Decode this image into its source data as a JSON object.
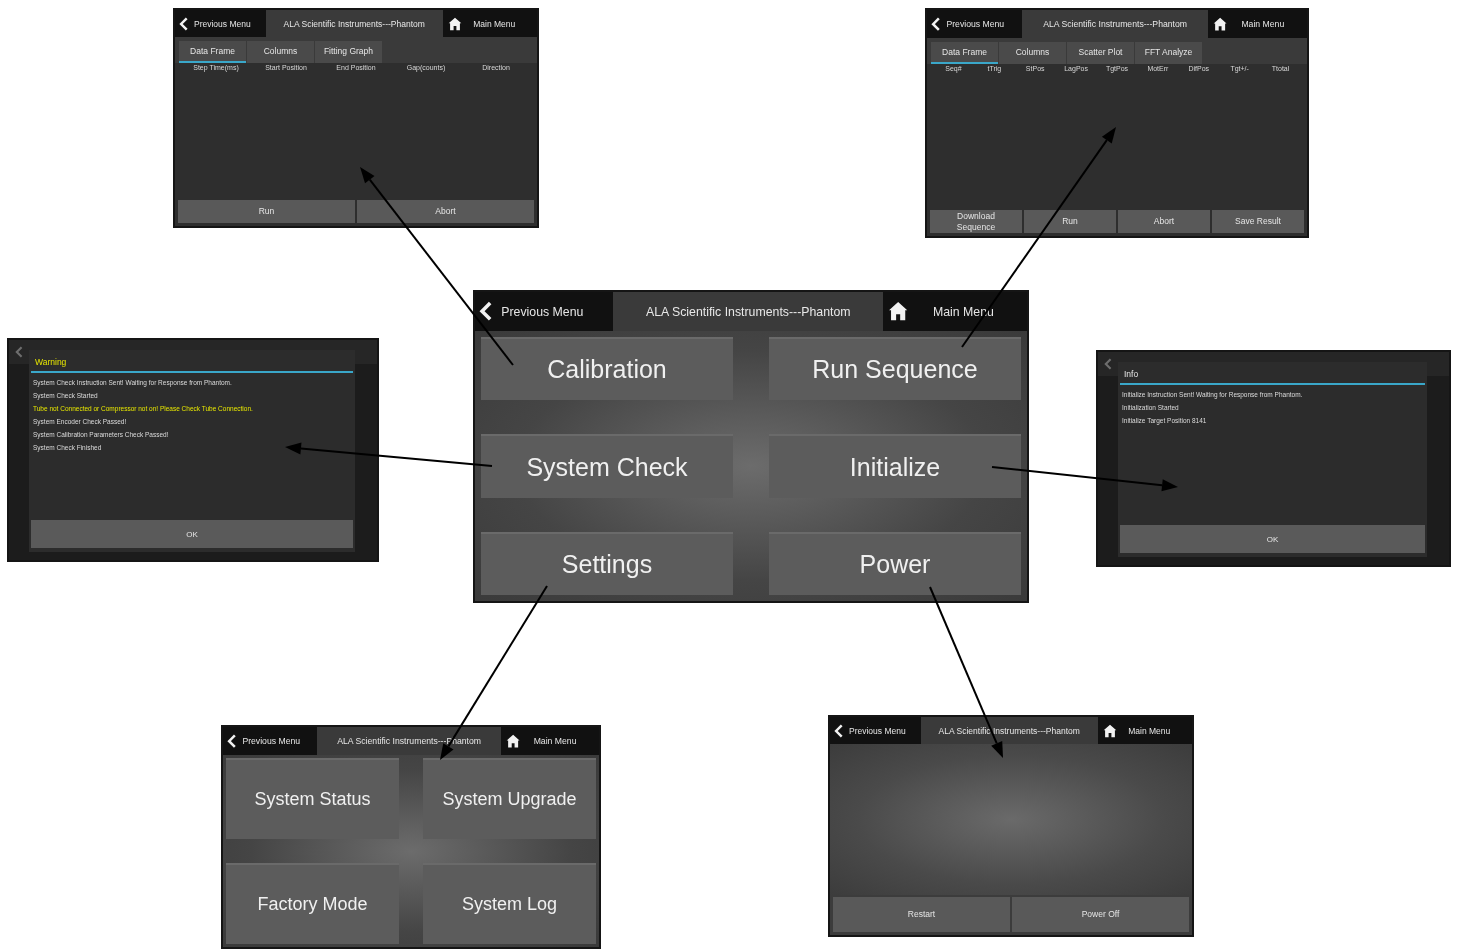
{
  "screens": [
    {
      "kind": "menu",
      "header": {
        "back": "Previous Menu",
        "title": "ALA Scientific Instruments---Phantom",
        "home": "Main Menu"
      },
      "buttons": [
        "Calibration",
        "Run Sequence",
        "System Check",
        "Initialize",
        "Settings",
        "Power"
      ]
    },
    {
      "kind": "table",
      "header": {
        "back": "Previous Menu",
        "title": "ALA Scientific Instruments---Phantom",
        "home": "Main Menu"
      },
      "tabs": [
        {
          "label": "Data Frame",
          "selected": true
        },
        {
          "label": "Columns",
          "selected": false
        },
        {
          "label": "Fitting Graph",
          "selected": false
        }
      ],
      "columns": [
        "Step Time(ms)",
        "Start Position",
        "End Position",
        "Gap(counts)",
        "Direction"
      ],
      "buttons": [
        "Run",
        "Abort"
      ]
    },
    {
      "kind": "table",
      "header": {
        "back": "Previous Menu",
        "title": "ALA Scientific Instruments---Phantom",
        "home": "Main Menu"
      },
      "tabs": [
        {
          "label": "Data Frame",
          "selected": true
        },
        {
          "label": "Columns",
          "selected": false
        },
        {
          "label": "Scatter Plot",
          "selected": false
        },
        {
          "label": "FFT Analyze",
          "selected": false
        }
      ],
      "columns": [
        "Seq#",
        "tTrig",
        "StPos",
        "LagPos",
        "TgtPos",
        "MotErr",
        "DifPos",
        "Tgt+/-",
        "Ttotal"
      ],
      "buttons": [
        "Download Sequence",
        "Run",
        "Abort",
        "Save Result"
      ]
    },
    {
      "kind": "warning-dialog",
      "title": "Warning",
      "messages": [
        {
          "text": "System Check Instruction Sent! Waiting for Response from Phantom.",
          "highlighted": false
        },
        {
          "text": "System Check Started",
          "highlighted": false
        },
        {
          "text": "Tube not Connected or Compressor not on! Please Check Tube Connection.",
          "highlighted": true
        },
        {
          "text": "System Encoder Check Passed!",
          "highlighted": false
        },
        {
          "text": "System Calibration Parameters Check Passed!",
          "highlighted": false
        },
        {
          "text": "System Check Finished",
          "highlighted": false
        }
      ],
      "button": "OK"
    },
    {
      "kind": "info-dialog",
      "title": "Info",
      "messages": [
        {
          "text": "Initialize Instruction Sent! Waiting for Response from Phantom.",
          "highlighted": false
        },
        {
          "text": "Initialization Started",
          "highlighted": false
        },
        {
          "text": "Initialize Target Position 8141",
          "highlighted": false
        }
      ],
      "button": "OK"
    },
    {
      "kind": "menu",
      "header": {
        "back": "Previous Menu",
        "title": "ALA Scientific Instruments---Phantom",
        "home": "Main Menu"
      },
      "buttons": [
        "System Status",
        "System Upgrade",
        "Factory Mode",
        "System Log"
      ]
    },
    {
      "kind": "actions",
      "header": {
        "back": "Previous Menu",
        "title": "ALA Scientific Instruments---Phantom",
        "home": "Main Menu"
      },
      "buttons": [
        "Restart",
        "Power Off"
      ]
    }
  ]
}
